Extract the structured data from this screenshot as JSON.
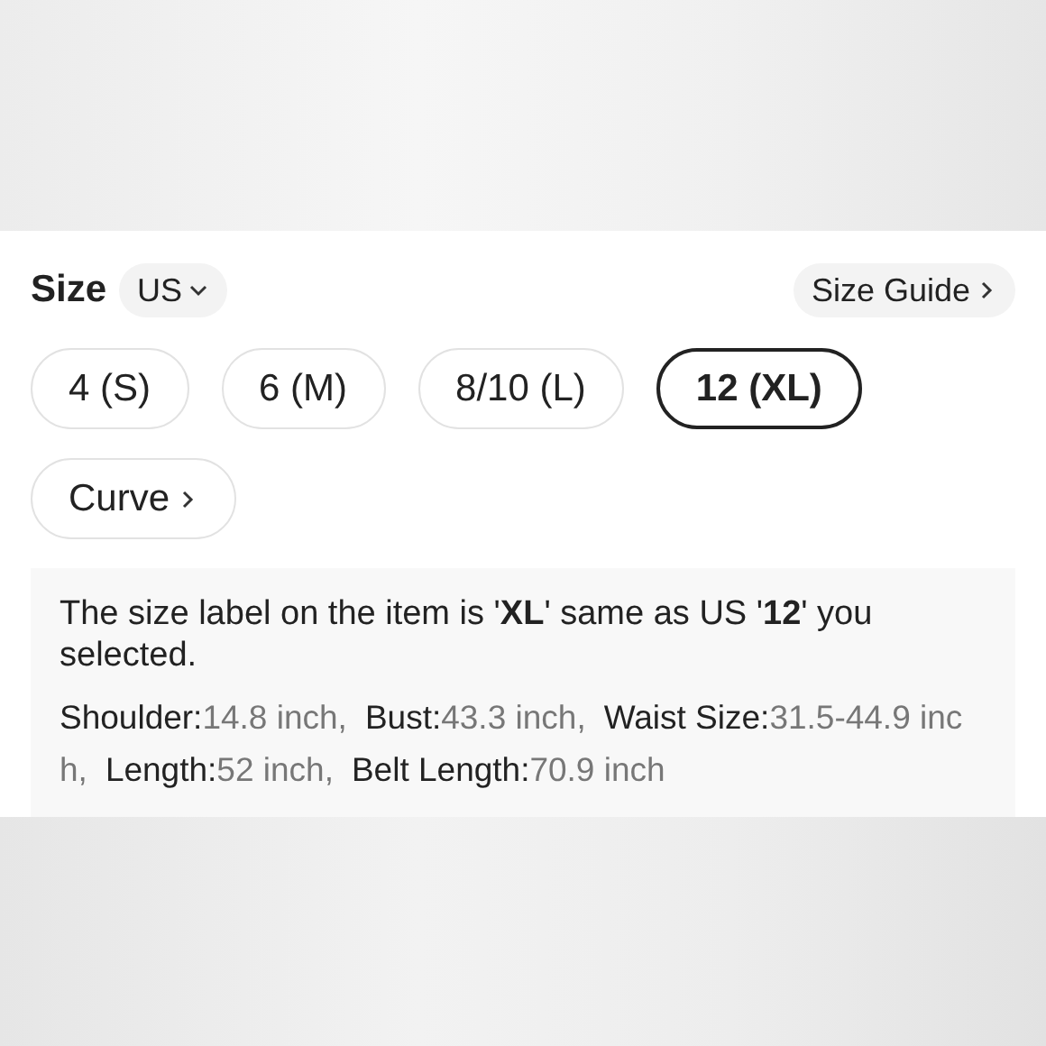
{
  "header": {
    "title": "Size",
    "unit": "US",
    "guide_link": "Size Guide"
  },
  "sizes": [
    {
      "label": "4 (S)",
      "selected": false,
      "kind": "size"
    },
    {
      "label": "6 (M)",
      "selected": false,
      "kind": "size"
    },
    {
      "label": "8/10 (L)",
      "selected": false,
      "kind": "size"
    },
    {
      "label": "12 (XL)",
      "selected": true,
      "kind": "size"
    },
    {
      "label": "Curve",
      "selected": false,
      "kind": "link"
    }
  ],
  "info": {
    "note": "The size label on the item is '**XL**' same as US '**12**' you selected.",
    "measurements": [
      {
        "label": "Shoulder:",
        "value": "14.8 inch,"
      },
      {
        "label": "Bust:",
        "value": "43.3 inch,"
      },
      {
        "label": "Waist Size:",
        "value": "31.5-44.9 inch,"
      },
      {
        "label": "Length:",
        "value": "52 inch,"
      },
      {
        "label": "Belt Length:",
        "value": "70.9 inch"
      }
    ]
  }
}
